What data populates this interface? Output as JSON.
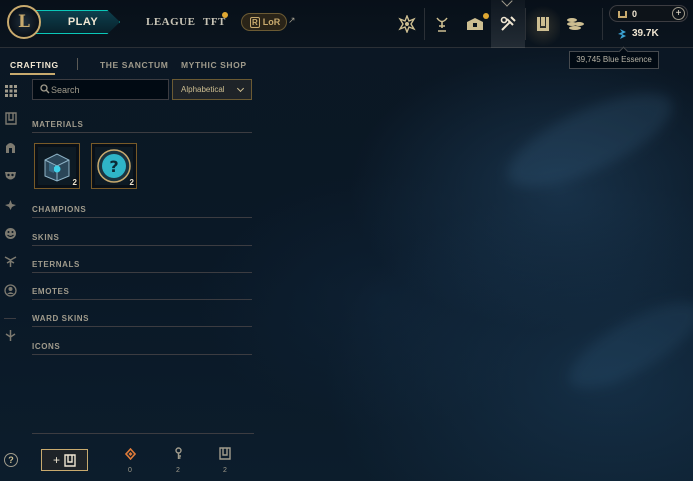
{
  "header": {
    "play_label": "PLAY",
    "nav": {
      "league": "LEAGUE",
      "tft": "TFT",
      "lor": "LoR"
    },
    "icons": [
      "clash-icon",
      "challenges-icon",
      "store-chest-icon",
      "loot-icon",
      "collection-icon",
      "store-icon"
    ],
    "currency": {
      "rp_value": "0",
      "be_value": "39.7K",
      "tooltip": "39,745 Blue Essence"
    }
  },
  "subnav": {
    "tabs": [
      {
        "label": "CRAFTING",
        "active": true
      },
      {
        "label": "THE SANCTUM",
        "active": false
      },
      {
        "label": "MYTHIC SHOP",
        "active": false
      }
    ]
  },
  "left_rail": {
    "icons": [
      "grid-icon",
      "chest-icon",
      "champion-helmet-icon",
      "skin-mask-icon",
      "eternals-icon",
      "emote-face-icon",
      "ward-icon",
      "profile-icon",
      "sword-icon"
    ]
  },
  "filters": {
    "search_placeholder": "Search",
    "search_value": "",
    "sort_selected": "Alphabetical"
  },
  "sections": {
    "materials": {
      "title": "MATERIALS",
      "items": [
        {
          "name": "hextech-chest",
          "count": "2"
        },
        {
          "name": "mystery-orb",
          "count": "2"
        }
      ]
    },
    "champions": "CHAMPIONS",
    "skins": "SKINS",
    "eternals": "ETERNALS",
    "emotes": "EMOTES",
    "ward_skins": "WARD SKINS",
    "icons": "ICONS"
  },
  "footer": {
    "add_button_label": "+",
    "stats": [
      {
        "icon": "orange-essence-icon",
        "count": "0",
        "color": "#e07b39"
      },
      {
        "icon": "key-icon",
        "count": "2",
        "color": "#a09b8c"
      },
      {
        "icon": "chest-icon",
        "count": "2",
        "color": "#a09b8c"
      }
    ]
  },
  "colors": {
    "gold": "#c8aa6e",
    "teal": "#0ac8b9",
    "text": "#a09b8c",
    "bright_text": "#f0e6d2",
    "background": "#0a1622"
  }
}
